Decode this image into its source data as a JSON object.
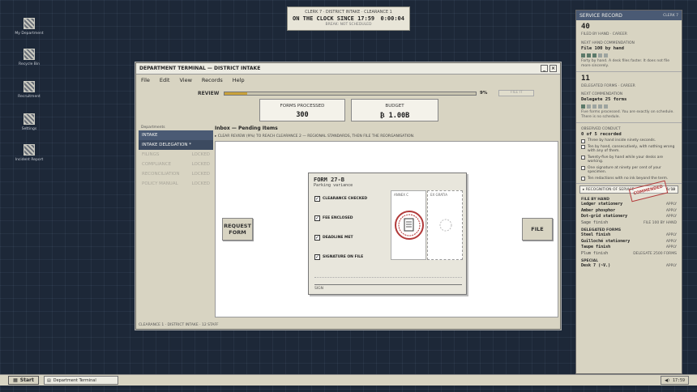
{
  "desktop": {
    "icons": [
      {
        "label": "My Department"
      },
      {
        "label": "Recycle Bin"
      },
      {
        "label": "Recruitment"
      },
      {
        "label": "Settings"
      },
      {
        "label": "Incident Report"
      }
    ]
  },
  "clock": {
    "line1": "CLERK 7 · DISTRICT INTAKE · CLEARANCE 1",
    "status": "ON THE CLOCK SINCE 17:59",
    "elapsed": "0:00:04",
    "line3": "BREAK: NOT SCHEDULED"
  },
  "window": {
    "title": "DEPARTMENT TERMINAL — DISTRICT INTAKE",
    "menu": [
      "File",
      "Edit",
      "View",
      "Records",
      "Help"
    ],
    "review_label": "REVIEW",
    "review_percent": "9%",
    "review_fraction": 0.09,
    "file_top_label": "FILE IT",
    "stats": [
      {
        "label": "FORMS PROCESSED",
        "value": "300"
      },
      {
        "label": "BUDGET",
        "value": "₿ 1.00B"
      }
    ],
    "sidebar": {
      "header": "Departments",
      "items": [
        {
          "label": "INTAKE",
          "state": ""
        },
        {
          "label": "INTAKE DELEGATION *",
          "state": ""
        },
        {
          "label": "FILINGS",
          "state": "LOCKED"
        },
        {
          "label": "COMPLIANCE",
          "state": "LOCKED"
        },
        {
          "label": "RECONCILIATION",
          "state": "LOCKED"
        },
        {
          "label": "POLICY MANUAL",
          "state": "LOCKED"
        }
      ]
    },
    "inbox_title": "Inbox — Pending Items",
    "inbox_sub": "▸ CLEAR REVIEW (9%) TO REACH CLEARANCE 2 — REGIONAL STANDARDS, THEN FILE THE REORGANISATION.",
    "request_btn": "REQUEST FORM",
    "file_btn": "FILE",
    "form": {
      "title": "FORM 27-B",
      "subtitle": "Parking variance",
      "checks": [
        "CLEARANCE CHECKED",
        "FEE ENCLOSED",
        "DEADLINE MET",
        "SIGNATURE ON FILE"
      ],
      "annex1": "ANNEX C",
      "annex2": "EX GRATIA",
      "sign_label": "SIGN"
    },
    "status": "CLEARANCE 1 · DISTRICT INTAKE · 12 STAFF"
  },
  "panel": {
    "title": "SERVICE RECORD",
    "clerk": "CLERK 7",
    "filed_count": "40",
    "filed_label": "FILED BY HAND · CAREER",
    "next_label": "NEXT HAND COMMENDATION",
    "next_value": "File 100 by hand",
    "hand_dots": [
      1,
      1,
      1,
      0,
      0
    ],
    "hand_note": "Forty by hand. A desk files faster. It does not file more sincerely.",
    "delegated_count": "11",
    "delegated_label": "DELEGATED FORMS · CAREER",
    "next2_label": "NEXT COMMENDATION",
    "next2_value": "Delegate 25 forms",
    "deleg_dots": [
      1,
      0,
      0,
      0,
      0
    ],
    "deleg_note": "Five forms processed. You are exactly on schedule. There is no schedule.",
    "observed_label": "OBSERVED CONDUCT",
    "observed_count": "0 of 5 recorded",
    "stamp": "COMMENDED",
    "conduct": [
      "Three by hand inside ninety seconds.",
      "Ten by hand, consecutively, with nothing wrong with any of them.",
      "Twenty-five by hand while your desks are working.",
      "One signature at ninety per cent of your specimen.",
      "Ten redactions with no ink beyond the term."
    ],
    "recognition_label": "▸ RECOGNITION OF SERVICE",
    "recognition_value": "6/10",
    "shop": [
      {
        "heading": "FILE BY HAND",
        "rows": [
          {
            "name": "Ledger stationery",
            "action": "APPLY"
          },
          {
            "name": "Amber phosphor",
            "action": "APPLY"
          },
          {
            "name": "Dot-grid stationery",
            "action": "APPLY"
          },
          {
            "name": "Sage finish",
            "action": "FILE 100 BY HAND",
            "sub": true
          }
        ]
      },
      {
        "heading": "DELEGATED FORMS",
        "rows": [
          {
            "name": "Steel finish",
            "action": "APPLY"
          },
          {
            "name": "Guilloché stationery",
            "action": "APPLY"
          },
          {
            "name": "Taupe finish",
            "action": "APPLY"
          },
          {
            "name": "Plum finish",
            "action": "DELEGATE 2500 FORMS",
            "sub": true
          }
        ]
      },
      {
        "heading": "SPECIAL",
        "rows": [
          {
            "name": "Desk 7 (~V.)",
            "action": "APPLY"
          }
        ]
      }
    ]
  },
  "taskbar": {
    "start": "Start",
    "task": "Department Terminal",
    "time": "17:59"
  }
}
